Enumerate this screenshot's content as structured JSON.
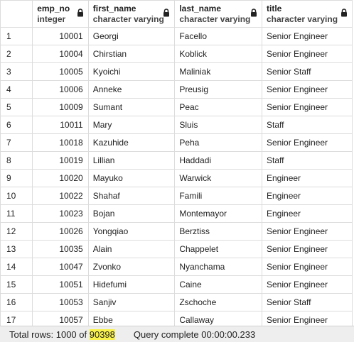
{
  "columns": [
    {
      "name": "",
      "type": ""
    },
    {
      "name": "emp_no",
      "type": "integer"
    },
    {
      "name": "first_name",
      "type": "character varying"
    },
    {
      "name": "last_name",
      "type": "character varying"
    },
    {
      "name": "title",
      "type": "character varying"
    }
  ],
  "rows": [
    [
      "1",
      "10001",
      "Georgi",
      "Facello",
      "Senior Engineer"
    ],
    [
      "2",
      "10004",
      "Chirstian",
      "Koblick",
      "Senior Engineer"
    ],
    [
      "3",
      "10005",
      "Kyoichi",
      "Maliniak",
      "Senior Staff"
    ],
    [
      "4",
      "10006",
      "Anneke",
      "Preusig",
      "Senior Engineer"
    ],
    [
      "5",
      "10009",
      "Sumant",
      "Peac",
      "Senior Engineer"
    ],
    [
      "6",
      "10011",
      "Mary",
      "Sluis",
      "Staff"
    ],
    [
      "7",
      "10018",
      "Kazuhide",
      "Peha",
      "Senior Engineer"
    ],
    [
      "8",
      "10019",
      "Lillian",
      "Haddadi",
      "Staff"
    ],
    [
      "9",
      "10020",
      "Mayuko",
      "Warwick",
      "Engineer"
    ],
    [
      "10",
      "10022",
      "Shahaf",
      "Famili",
      "Engineer"
    ],
    [
      "11",
      "10023",
      "Bojan",
      "Montemayor",
      "Engineer"
    ],
    [
      "12",
      "10026",
      "Yongqiao",
      "Berztiss",
      "Senior Engineer"
    ],
    [
      "13",
      "10035",
      "Alain",
      "Chappelet",
      "Senior Engineer"
    ],
    [
      "14",
      "10047",
      "Zvonko",
      "Nyanchama",
      "Senior Engineer"
    ],
    [
      "15",
      "10051",
      "Hidefumi",
      "Caine",
      "Senior Engineer"
    ],
    [
      "16",
      "10053",
      "Sanjiv",
      "Zschoche",
      "Senior Staff"
    ],
    [
      "17",
      "10057",
      "Ebbe",
      "Callaway",
      "Senior Engineer"
    ]
  ],
  "status": {
    "total_prefix": "Total rows: 1000 of ",
    "total_count": "90398",
    "query": "Query complete 00:00:00.233"
  }
}
